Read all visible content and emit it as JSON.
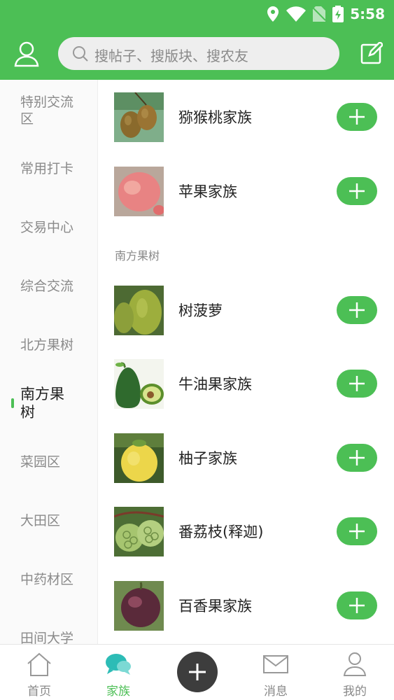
{
  "status_bar": {
    "time": "5:58"
  },
  "header": {
    "search_placeholder": "搜帖子、搜版块、搜农友",
    "background_color": "#4cbf55"
  },
  "sidebar": {
    "items": [
      {
        "label": "特别交流区",
        "active": false
      },
      {
        "label": "常用打卡",
        "active": false
      },
      {
        "label": "交易中心",
        "active": false
      },
      {
        "label": "综合交流",
        "active": false
      },
      {
        "label": "北方果树",
        "active": false
      },
      {
        "label": "南方果树",
        "active": true
      },
      {
        "label": "菜园区",
        "active": false
      },
      {
        "label": "大田区",
        "active": false
      },
      {
        "label": "中药材区",
        "active": false
      },
      {
        "label": "田间大学",
        "active": false
      }
    ]
  },
  "content": {
    "rows_top": [
      {
        "title": "猕猴桃家族",
        "thumb_icon": "kiwi-fruit-photo"
      },
      {
        "title": "苹果家族",
        "thumb_icon": "apple-photo"
      }
    ],
    "section_label": "南方果树",
    "rows_south": [
      {
        "title": "树菠萝",
        "thumb_icon": "jackfruit-photo"
      },
      {
        "title": "牛油果家族",
        "thumb_icon": "avocado-photo"
      },
      {
        "title": "柚子家族",
        "thumb_icon": "pomelo-photo"
      },
      {
        "title": "番荔枝(释迦)",
        "thumb_icon": "sugar-apple-photo"
      },
      {
        "title": "百香果家族",
        "thumb_icon": "passion-fruit-photo"
      }
    ]
  },
  "bottom_nav": {
    "items": [
      {
        "label": "首页",
        "icon": "home-icon",
        "active": false
      },
      {
        "label": "家族",
        "icon": "chat-bubbles-icon",
        "active": true
      },
      {
        "label": "",
        "icon": "plus-icon",
        "active": false
      },
      {
        "label": "消息",
        "icon": "mail-icon",
        "active": false
      },
      {
        "label": "我的",
        "icon": "user-icon",
        "active": false
      }
    ]
  },
  "colors": {
    "accent": "#4cbf55",
    "fab": "#3d3d3d"
  }
}
